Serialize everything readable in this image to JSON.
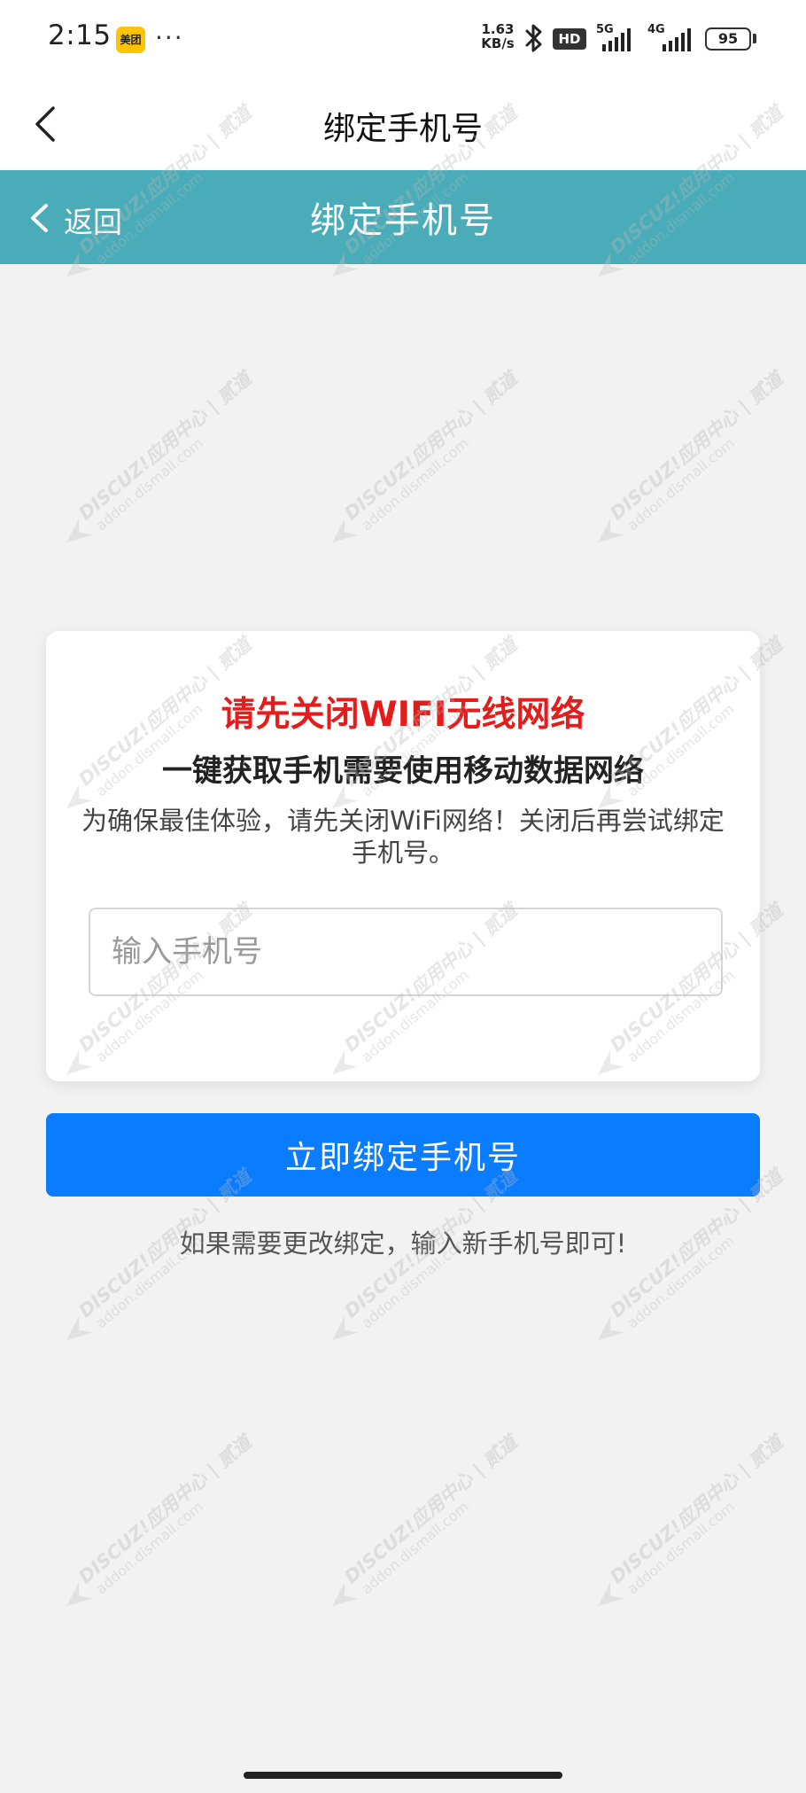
{
  "status_bar": {
    "time": "2:15",
    "app_icon_label": "美团",
    "more_dots": "···",
    "net_speed_value": "1.63",
    "net_speed_unit": "KB/s",
    "hd_label": "HD",
    "net_type_1": "5G",
    "net_type_2": "4G",
    "battery_level": "95",
    "icons": [
      "bluetooth-icon",
      "signal-5g-icon",
      "signal-4g-icon",
      "battery-icon"
    ]
  },
  "app_nav": {
    "title": "绑定手机号",
    "back_icon": "chevron-left-icon"
  },
  "web_header": {
    "back_label": "返回",
    "title": "绑定手机号",
    "background_color": "#4aacb8"
  },
  "card": {
    "warning": "请先关闭WIFI无线网络",
    "warning_color": "#e31c1c",
    "subtitle": "一键获取手机需要使用移动数据网络",
    "description": "为确保最佳体验，请先关闭WiFi网络！关闭后再尝试绑定手机号。",
    "phone_input": {
      "placeholder": "输入手机号",
      "value": ""
    }
  },
  "submit_button": {
    "label": "立即绑定手机号",
    "color": "#0a7cff"
  },
  "hint": "如果需要更改绑定，输入新手机号即可!",
  "watermark": {
    "line1": "DISCUZ!应用中心 | 贰道",
    "line2": "addon.dismall.com"
  }
}
